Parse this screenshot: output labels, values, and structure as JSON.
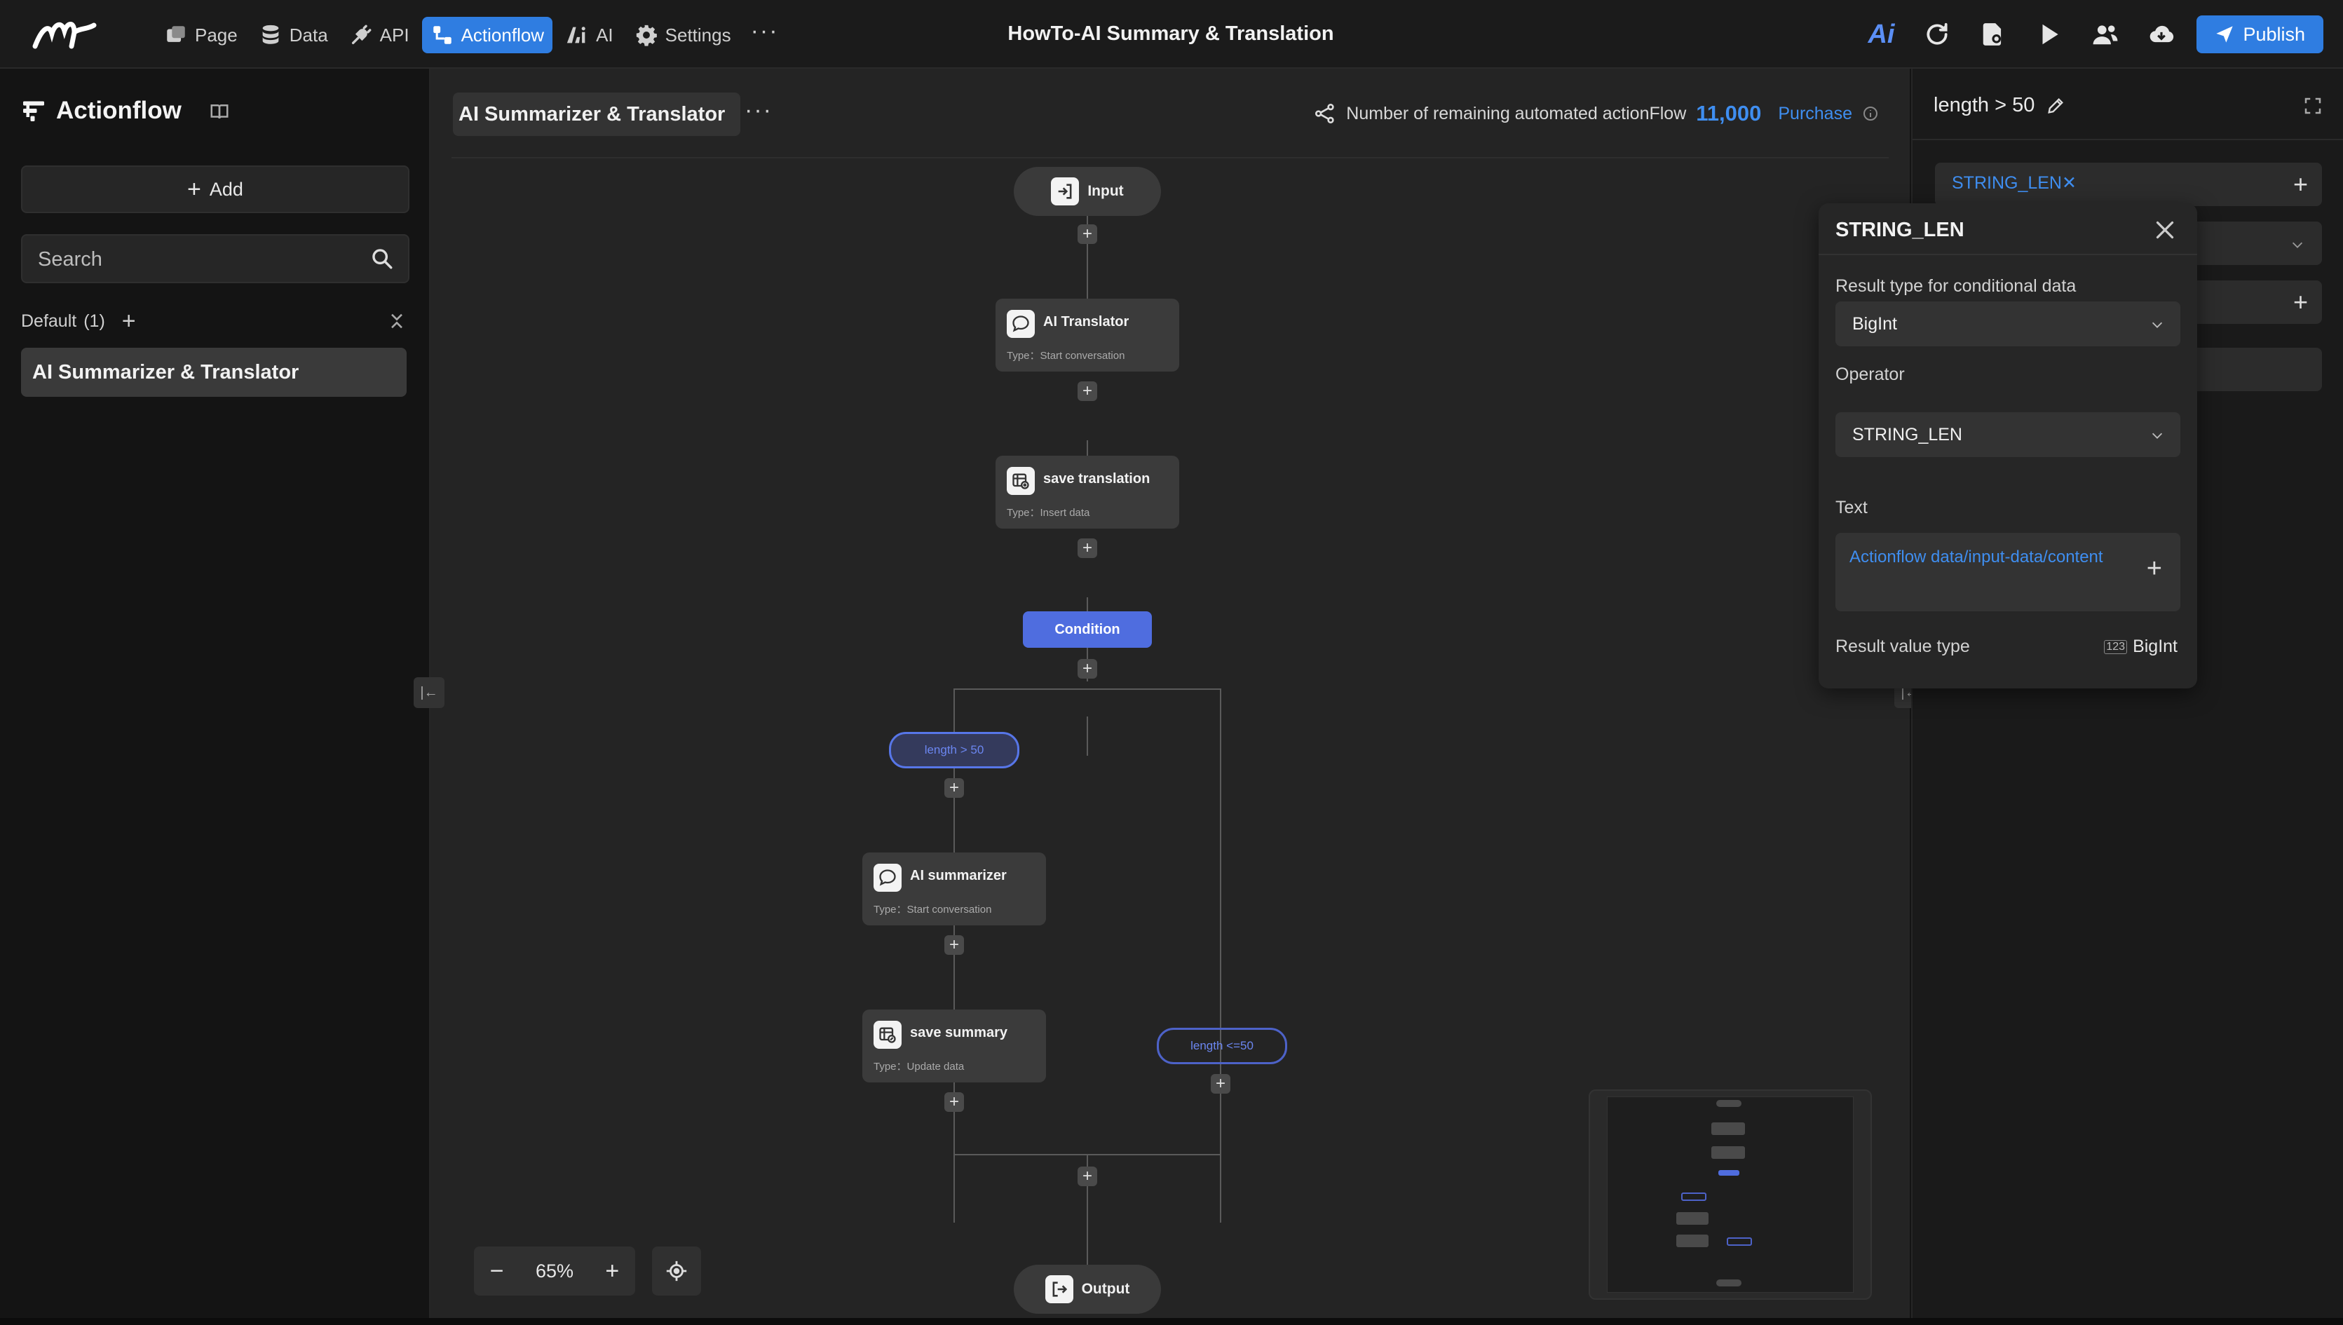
{
  "topbar": {
    "nav": [
      {
        "label": "Page",
        "icon": "page-icon"
      },
      {
        "label": "Data",
        "icon": "database-icon"
      },
      {
        "label": "API",
        "icon": "plug-icon"
      },
      {
        "label": "Actionflow",
        "icon": "flow-icon",
        "active": true
      },
      {
        "label": "AI",
        "icon": "ai-icon"
      },
      {
        "label": "Settings",
        "icon": "gear-icon"
      }
    ],
    "more": "···",
    "title": "HowTo-AI Summary & Translation",
    "ai_logo": "Ai",
    "publish_label": "Publish",
    "accent_color": "#2f7de1"
  },
  "sidebar": {
    "title": "Actionflow",
    "add_label": "Add",
    "search_placeholder": "Search",
    "group": {
      "name": "Default",
      "count": "(1)"
    },
    "items": [
      {
        "label": "AI Summarizer & Translator",
        "selected": true
      }
    ]
  },
  "canvas": {
    "flow_title": "AI Summarizer & Translator",
    "remaining_label": "Number of remaining automated actionFlow",
    "remaining_count": "11,000",
    "purchase_label": "Purchase",
    "zoom": "65%",
    "nodes": {
      "input": {
        "label": "Input"
      },
      "translator": {
        "title": "AI Translator",
        "type": "Type：Start conversation"
      },
      "save_translation": {
        "title": "save translation",
        "type": "Type：Insert data"
      },
      "condition": {
        "label": "Condition"
      },
      "branch_left": {
        "label": "length > 50"
      },
      "summarizer": {
        "title": "AI summarizer",
        "type": "Type：Start conversation"
      },
      "save_summary": {
        "title": "save summary",
        "type": "Type：Update data"
      },
      "branch_right": {
        "label": "length <=50"
      },
      "output": {
        "label": "Output"
      }
    }
  },
  "right_panel": {
    "title": "length > 50",
    "token": "STRING_LEN"
  },
  "popover": {
    "title": "STRING_LEN",
    "result_type_label": "Result type for conditional data",
    "result_type_value": "BigInt",
    "operator_label": "Operator",
    "operator_value": "STRING_LEN",
    "text_label": "Text",
    "text_value": "Actionflow data/input-data/content",
    "result_value_type_label": "Result value type",
    "result_value_type_icon_text": "123",
    "result_value_type": "BigInt"
  }
}
